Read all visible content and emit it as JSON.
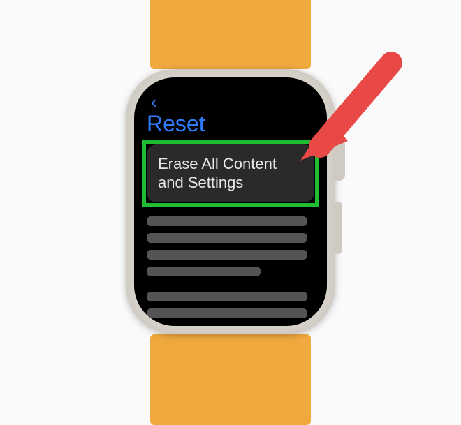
{
  "reset": {
    "title": "Reset",
    "erase_label": "Erase All Content and Settings"
  },
  "colors": {
    "accent": "#2f7cff",
    "highlight": "#1fbd2f",
    "arrow": "#e84846",
    "band": "#f0a93e"
  }
}
